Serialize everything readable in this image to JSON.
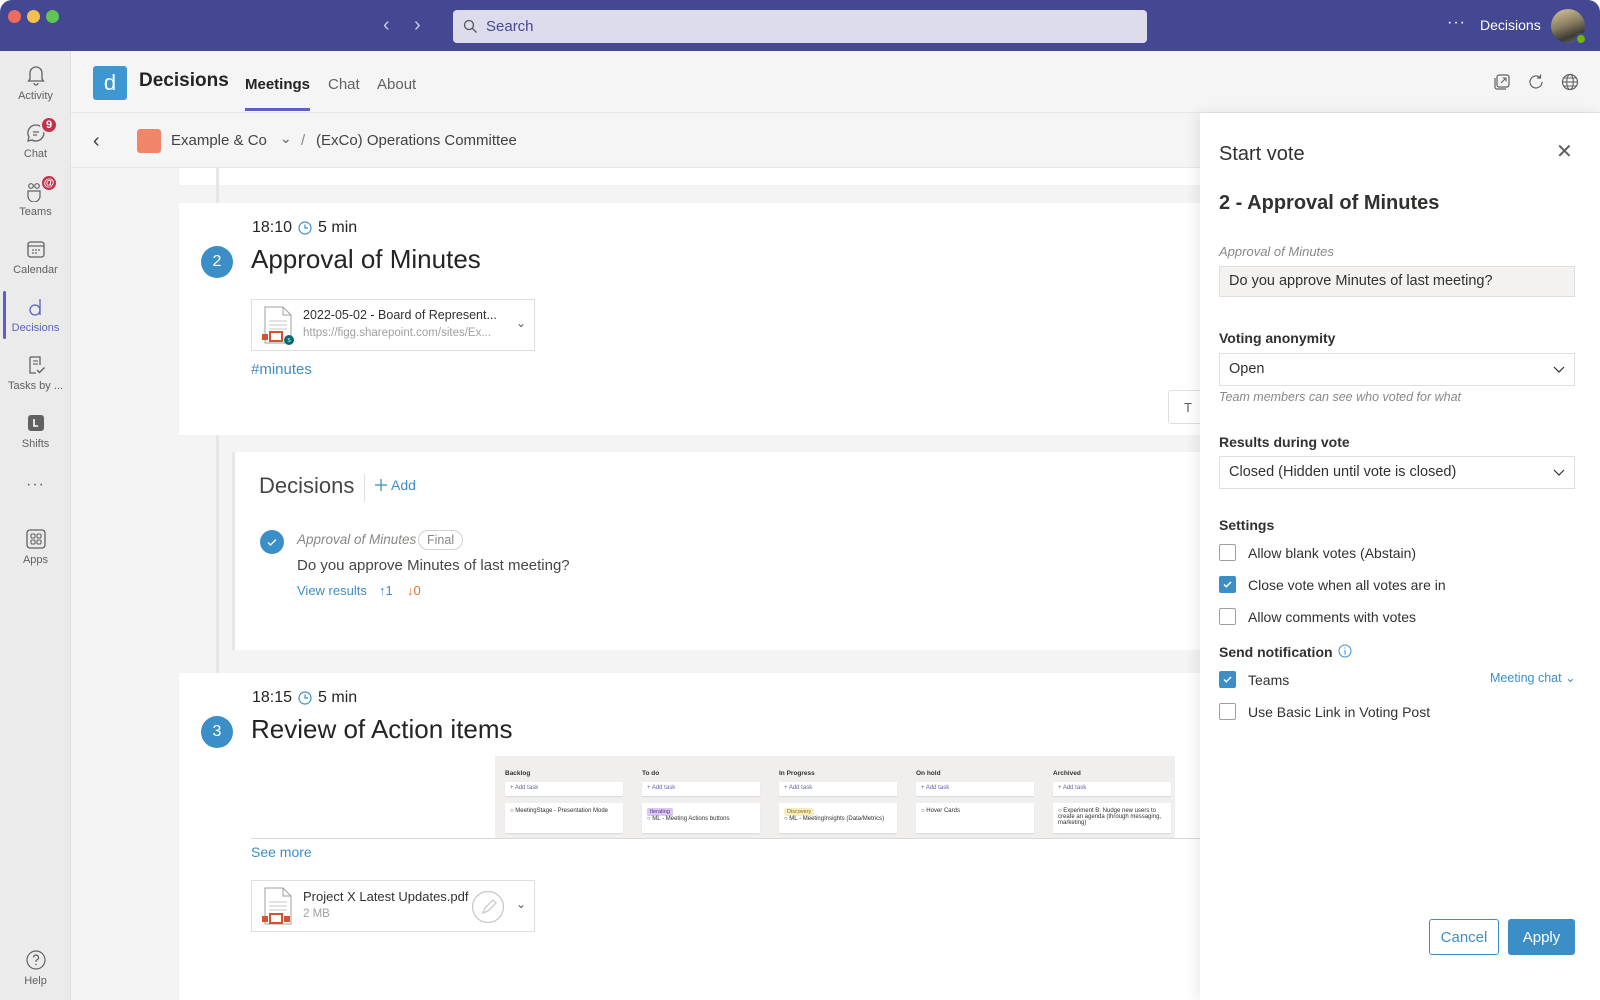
{
  "titlebar": {
    "search_placeholder": "Search",
    "more_label": "···",
    "app_name": "Decisions"
  },
  "rail": {
    "items": [
      {
        "label": "Activity",
        "icon": "bell-icon"
      },
      {
        "label": "Chat",
        "icon": "chat-icon",
        "badge": "9"
      },
      {
        "label": "Teams",
        "icon": "teams-icon",
        "badge": "@"
      },
      {
        "label": "Calendar",
        "icon": "calendar-icon"
      },
      {
        "label": "Decisions",
        "icon": "decisions-icon",
        "active": true
      },
      {
        "label": "Tasks by ...",
        "icon": "tasks-icon"
      },
      {
        "label": "Shifts",
        "icon": "shifts-icon"
      },
      {
        "label": "···",
        "icon": "more-icon"
      },
      {
        "label": "Apps",
        "icon": "apps-icon"
      },
      {
        "label": "Help",
        "icon": "help-icon"
      }
    ]
  },
  "apphead": {
    "logo_letter": "d",
    "title": "Decisions",
    "tabs": [
      {
        "label": "Meetings",
        "active": true
      },
      {
        "label": "Chat"
      },
      {
        "label": "About"
      }
    ]
  },
  "breadcrumb": {
    "org": "Example & Co",
    "separator": "/",
    "committee": "(ExCo) Operations Committee"
  },
  "agenda": {
    "item2": {
      "time": "18:10",
      "duration": "5 min",
      "number": "2",
      "title": "Approval of Minutes",
      "file": {
        "name": "2022-05-02 - Board of Represent...",
        "url": "https://figg.sharepoint.com/sites/Ex..."
      },
      "tag": "#minutes",
      "partial_button": "T"
    },
    "decisions": {
      "title": "Decisions",
      "add_label": "Add",
      "item": {
        "name": "Approval of Minutes",
        "status": "Final",
        "question": "Do you approve Minutes of last meeting?",
        "view_results": "View results",
        "votes_up": "1",
        "votes_down": "0"
      }
    },
    "item3": {
      "time": "18:15",
      "duration": "5 min",
      "number": "3",
      "title": "Review of Action items",
      "planner": {
        "columns": [
          {
            "name": "Backlog",
            "add": "Add task",
            "card": "MeetingStage - Presentation Mode",
            "label": ""
          },
          {
            "name": "To do",
            "add": "Add task",
            "card": "ML - Meeting Actions buttons",
            "label": "Iterating"
          },
          {
            "name": "In Progress",
            "add": "Add task",
            "card": "ML - MeetingInsights (Data/Metrics)",
            "label": "Discovery"
          },
          {
            "name": "On hold",
            "add": "Add task",
            "card": "Hover Cards",
            "label": ""
          },
          {
            "name": "Archived",
            "add": "Add task",
            "card": "Experiment B: Nudge new users to create an agenda (through messaging, marketing)",
            "label": ""
          }
        ]
      },
      "see_more": "See more",
      "file": {
        "name": "Project X Latest Updates.pdf",
        "size": "2 MB"
      }
    }
  },
  "panel": {
    "title": "Start vote",
    "subtitle": "2 - Approval of Minutes",
    "question_label": "Approval of Minutes",
    "question_value": "Do you approve Minutes of last meeting?",
    "anonymity_label": "Voting anonymity",
    "anonymity_value": "Open",
    "anonymity_hint": "Team members can see who voted for what",
    "results_label": "Results during vote",
    "results_value": "Closed (Hidden until vote is closed)",
    "settings_label": "Settings",
    "settings": [
      {
        "label": "Allow blank votes (Abstain)",
        "checked": false
      },
      {
        "label": "Close vote when all votes are in",
        "checked": true
      },
      {
        "label": "Allow comments with votes",
        "checked": false
      }
    ],
    "notification_label": "Send notification",
    "notifications": [
      {
        "label": "Teams",
        "checked": true
      },
      {
        "label": "Use Basic Link in Voting Post",
        "checked": false
      }
    ],
    "channel_select": "Meeting chat",
    "cancel_label": "Cancel",
    "apply_label": "Apply"
  },
  "colors": {
    "titlebar": "#444791",
    "accent": "#3c8fc6",
    "teams_purple": "#5b5fc7",
    "badge_red": "#c4314b",
    "vote_down": "#e3702f"
  }
}
